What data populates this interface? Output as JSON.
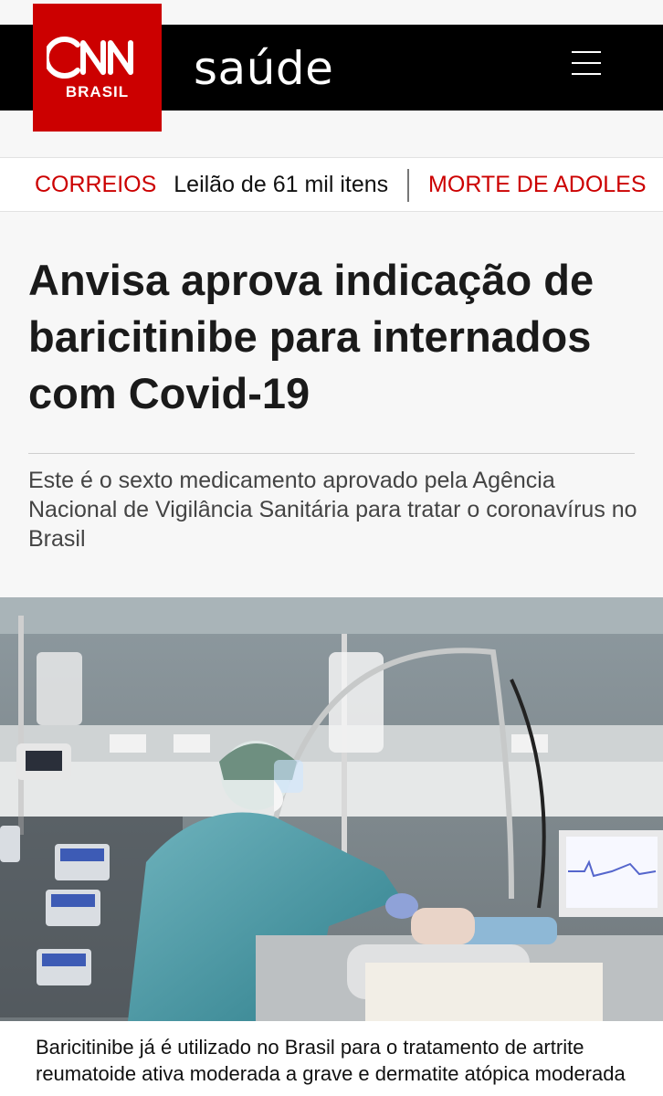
{
  "brand": {
    "logo_word": "CNN",
    "logo_sub": "BRASIL",
    "section": "saúde",
    "accent_color": "#cc0000"
  },
  "menu": {
    "icon": "hamburger-menu-icon"
  },
  "ticker": {
    "items": [
      {
        "tag": "CORREIOS",
        "text": "Leilão de 61 mil itens"
      },
      {
        "tag": "MORTE DE ADOLES",
        "text": ""
      }
    ]
  },
  "article": {
    "headline": "Anvisa aprova indicação de baricitinibe para internados com Covid-19",
    "subheadline": "Este é o sexto medicamento aprovado pela Agência Nacional de Vigilância Sanitária para tratar o coronavírus no Brasil",
    "photo_caption": "Baricitinibe já é utilizado no Brasil para o tratamento de artrite reumatoide ativa moderada a grave e dermatite atópica moderada a grave"
  }
}
